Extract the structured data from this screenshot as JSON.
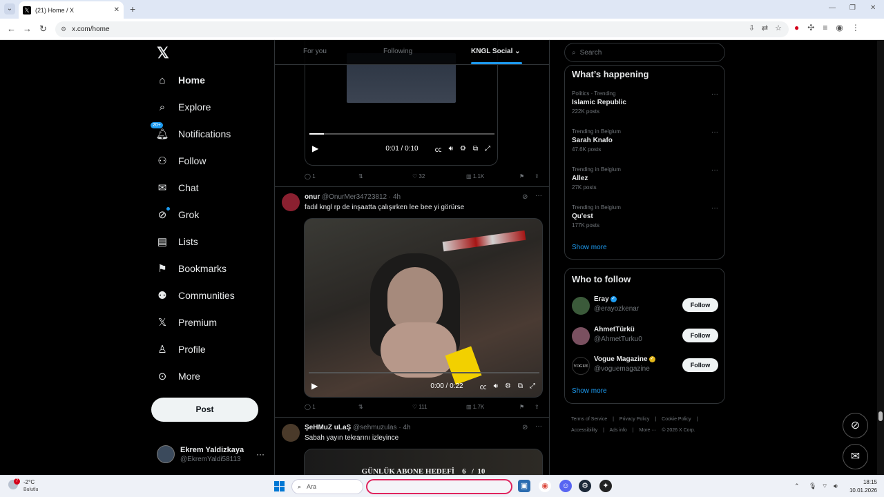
{
  "browser": {
    "tab_title": "(21) Home / X",
    "new_tab": "+",
    "url": "x.com/home"
  },
  "nav": {
    "items": [
      {
        "label": "Home",
        "icon": "home-icon"
      },
      {
        "label": "Explore",
        "icon": "search-icon"
      },
      {
        "label": "Notifications",
        "icon": "bell-icon",
        "badge": "20+"
      },
      {
        "label": "Follow",
        "icon": "person-add-icon"
      },
      {
        "label": "Chat",
        "icon": "mail-icon"
      },
      {
        "label": "Grok",
        "icon": "grok-icon"
      },
      {
        "label": "Lists",
        "icon": "list-icon"
      },
      {
        "label": "Bookmarks",
        "icon": "bookmark-icon"
      },
      {
        "label": "Communities",
        "icon": "people-icon"
      },
      {
        "label": "Premium",
        "icon": "x-icon"
      },
      {
        "label": "Profile",
        "icon": "profile-icon"
      },
      {
        "label": "More",
        "icon": "more-circle-icon"
      }
    ],
    "post_label": "Post",
    "account": {
      "name": "Ekrem Yaldizkaya",
      "handle": "@EkremYaldi58113"
    }
  },
  "feed": {
    "tabs": [
      "For you",
      "Following",
      "KNGL Social"
    ],
    "video1": {
      "time": "0:01 / 0:10",
      "progress": 0.08
    },
    "actions1": {
      "replies": "1",
      "likes": "32",
      "views": "1.1K"
    },
    "tweet2": {
      "name": "onur",
      "handle": "@OnurMer34723812",
      "age": "· 4h",
      "text": "fadıl kngl rp de inşaatta çalışırken lee bee yi görürse",
      "video_time": "0:00 / 0:22",
      "replies": "1",
      "likes": "111",
      "views": "1.7K"
    },
    "tweet3": {
      "name": "ŞeHMuZ uLaŞ",
      "handle": "@sehmuzulas",
      "age": "· 4h",
      "text": "Sabah yayın tekrarını izleyince",
      "media_text": "GÜNLÜK ABONE HEDEFİ    6   /  10"
    }
  },
  "right": {
    "search_placeholder": "Search",
    "happening_title": "What’s happening",
    "trends": [
      {
        "meta": "Politics · Trending",
        "topic": "Islamic Republic",
        "posts": "222K posts"
      },
      {
        "meta": "Trending in Belgium",
        "topic": "Sarah Knafo",
        "posts": "47.6K posts"
      },
      {
        "meta": "Trending in Belgium",
        "topic": "Allez",
        "posts": "27K posts"
      },
      {
        "meta": "Trending in Belgium",
        "topic": "Qu'est",
        "posts": "177K posts"
      }
    ],
    "show_more": "Show more",
    "who_title": "Who to follow",
    "who": [
      {
        "name": "Eray",
        "handle": "@erayozkenar",
        "badge": "blue"
      },
      {
        "name": "AhmetTürkü",
        "handle": "@AhmetTurku0",
        "badge": ""
      },
      {
        "name": "Vogue Magazine",
        "handle": "@voguemagazine",
        "badge": "gold"
      }
    ],
    "follow_label": "Follow",
    "footer": [
      "Terms of Service",
      "|",
      "Privacy Policy",
      "|",
      "Cookie Policy",
      "|",
      "Accessibility",
      "|",
      "Ads info",
      "|",
      "More ···",
      "© 2026 X Corp."
    ]
  },
  "taskbar": {
    "temp": "-2°C",
    "condition": "Bulutlu",
    "weather_badge": "7",
    "search": "Ara",
    "time": "18:15",
    "date": "10.01.2026"
  },
  "colors": {
    "accent": "#1d9bf0",
    "bg": "#000000",
    "border": "#2f3336",
    "muted": "#71767b"
  }
}
